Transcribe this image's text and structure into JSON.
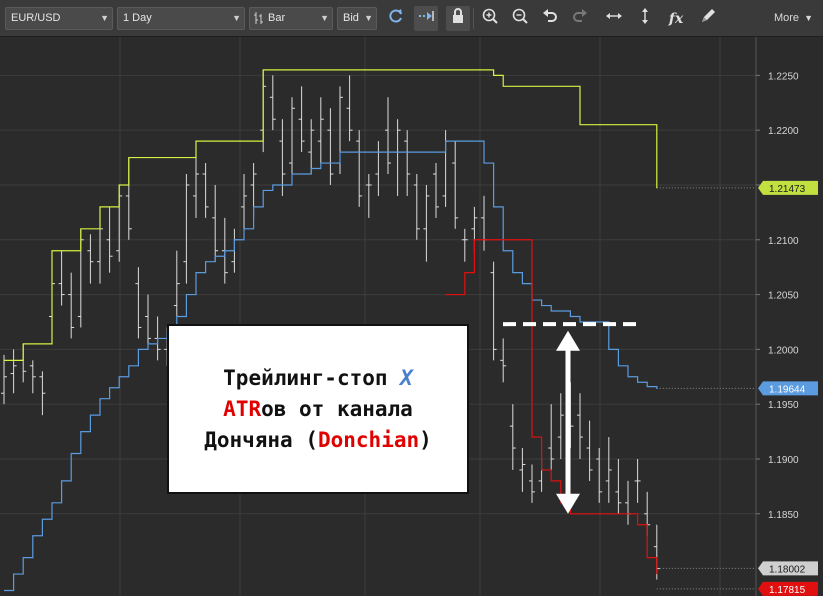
{
  "toolbar": {
    "symbol": "EUR/USD",
    "timeframe": "1 Day",
    "chart_type": "Bar",
    "price_type": "Bid",
    "more_label": "More",
    "icons": [
      "refresh-icon",
      "auto-scroll-icon",
      "lock-icon",
      "zoom-in-icon",
      "zoom-out-icon",
      "undo-icon",
      "redo-icon",
      "horizontal-fit-icon",
      "vertical-fit-icon",
      "indicators-fx-icon",
      "draw-pencil-icon"
    ]
  },
  "annotation": {
    "line1_a": "Трейлинг-стоп ",
    "line1_b": "X",
    "line2_a": "ATR",
    "line2_b": "ов от канала",
    "line3_a": "Дончяна (",
    "line3_b": "Donchian",
    "line3_c": ")",
    "colors": {
      "text": "#111111",
      "x": "#4a7fd0",
      "red": "#e00000"
    }
  },
  "chart_data": {
    "type": "bar",
    "price_axis": {
      "ylim": [
        1.1775,
        1.2285
      ],
      "ticks": [
        "1.2250",
        "1.2200",
        "1.2150",
        "1.2100",
        "1.2050",
        "1.2000",
        "1.1950",
        "1.1900",
        "1.1850"
      ]
    },
    "series": [
      {
        "name": "EUR/USD",
        "color": "#dcdcdc",
        "ohlc": [
          [
            1.196,
            1.1995,
            1.195,
            1.1975
          ],
          [
            1.1978,
            1.2,
            1.196,
            1.1985
          ],
          [
            1.199,
            1.2005,
            1.197,
            1.198
          ],
          [
            1.1985,
            1.199,
            1.196,
            1.1975
          ],
          [
            1.1975,
            1.198,
            1.194,
            1.196
          ],
          [
            1.203,
            1.208,
            1.202,
            1.206
          ],
          [
            1.206,
            1.209,
            1.204,
            1.205
          ],
          [
            1.205,
            1.207,
            1.201,
            1.202
          ],
          [
            1.203,
            1.211,
            1.202,
            1.21
          ],
          [
            1.209,
            1.2105,
            1.206,
            1.208
          ],
          [
            1.208,
            1.212,
            1.206,
            1.211
          ],
          [
            1.21,
            1.213,
            1.207,
            1.2085
          ],
          [
            1.209,
            1.215,
            1.208,
            1.214
          ],
          [
            1.214,
            1.2175,
            1.21,
            1.211
          ],
          [
            1.206,
            1.2075,
            1.201,
            1.202
          ],
          [
            1.203,
            1.205,
            1.2,
            1.201
          ],
          [
            1.201,
            1.203,
            1.199,
            1.2
          ],
          [
            1.2,
            1.202,
            1.1985,
            1.1995
          ],
          [
            1.204,
            1.209,
            1.203,
            1.206
          ],
          [
            1.208,
            1.216,
            1.206,
            1.215
          ],
          [
            1.214,
            1.219,
            1.212,
            1.216
          ],
          [
            1.216,
            1.217,
            1.212,
            1.213
          ],
          [
            1.212,
            1.215,
            1.208,
            1.209
          ],
          [
            1.209,
            1.212,
            1.206,
            1.207
          ],
          [
            1.208,
            1.211,
            1.207,
            1.21
          ],
          [
            1.213,
            1.216,
            1.211,
            1.214
          ],
          [
            1.215,
            1.217,
            1.212,
            1.216
          ],
          [
            1.22,
            1.2255,
            1.218,
            1.224
          ],
          [
            1.223,
            1.225,
            1.22,
            1.221
          ],
          [
            1.219,
            1.221,
            1.214,
            1.216
          ],
          [
            1.217,
            1.223,
            1.215,
            1.222
          ],
          [
            1.221,
            1.224,
            1.218,
            1.219
          ],
          [
            1.218,
            1.221,
            1.216,
            1.22
          ],
          [
            1.219,
            1.223,
            1.217,
            1.221
          ],
          [
            1.22,
            1.222,
            1.215,
            1.216
          ],
          [
            1.217,
            1.224,
            1.216,
            1.223
          ],
          [
            1.222,
            1.225,
            1.219,
            1.22
          ],
          [
            1.219,
            1.22,
            1.213,
            1.214
          ],
          [
            1.215,
            1.216,
            1.212,
            1.215
          ],
          [
            1.216,
            1.219,
            1.214,
            1.218
          ],
          [
            1.22,
            1.223,
            1.216,
            1.217
          ],
          [
            1.218,
            1.221,
            1.214,
            1.22
          ],
          [
            1.219,
            1.22,
            1.214,
            1.216
          ],
          [
            1.215,
            1.216,
            1.21,
            1.211
          ],
          [
            1.211,
            1.215,
            1.208,
            1.214
          ],
          [
            1.216,
            1.217,
            1.212,
            1.213
          ],
          [
            1.214,
            1.22,
            1.213,
            1.219
          ],
          [
            1.217,
            1.219,
            1.211,
            1.212
          ],
          [
            1.21,
            1.211,
            1.208,
            1.21
          ],
          [
            1.211,
            1.213,
            1.209,
            1.212
          ],
          [
            1.212,
            1.214,
            1.209,
            1.21
          ],
          [
            1.207,
            1.208,
            1.199,
            1.2
          ],
          [
            1.199,
            1.201,
            1.197,
            1.1985
          ],
          [
            1.193,
            1.195,
            1.189,
            1.191
          ],
          [
            1.189,
            1.191,
            1.187,
            1.1895
          ],
          [
            1.188,
            1.1895,
            1.186,
            1.187
          ],
          [
            1.188,
            1.19,
            1.187,
            1.189
          ],
          [
            1.191,
            1.195,
            1.189,
            1.19
          ],
          [
            1.192,
            1.196,
            1.19,
            1.194
          ],
          [
            1.194,
            1.197,
            1.191,
            1.193
          ],
          [
            1.194,
            1.196,
            1.19,
            1.192
          ],
          [
            1.191,
            1.1935,
            1.188,
            1.189
          ],
          [
            1.19,
            1.191,
            1.186,
            1.187
          ],
          [
            1.188,
            1.192,
            1.186,
            1.189
          ],
          [
            1.187,
            1.19,
            1.185,
            1.186
          ],
          [
            1.186,
            1.188,
            1.184,
            1.185
          ],
          [
            1.188,
            1.19,
            1.186,
            1.188
          ],
          [
            1.185,
            1.187,
            1.183,
            1.184
          ],
          [
            1.182,
            1.184,
            1.179,
            1.18
          ]
        ]
      },
      {
        "name": "Donchian upper",
        "color": "#d8f040",
        "values": [
          1.199,
          1.199,
          1.2005,
          1.2005,
          1.2005,
          1.209,
          1.209,
          1.209,
          1.211,
          1.211,
          1.213,
          1.213,
          1.215,
          1.2175,
          1.2175,
          1.2175,
          1.2175,
          1.2175,
          1.2175,
          1.2175,
          1.219,
          1.219,
          1.219,
          1.219,
          1.219,
          1.219,
          1.219,
          1.2255,
          1.2255,
          1.2255,
          1.2255,
          1.2255,
          1.2255,
          1.2255,
          1.2255,
          1.2255,
          1.2255,
          1.2255,
          1.2255,
          1.2255,
          1.2255,
          1.2255,
          1.2255,
          1.2255,
          1.2255,
          1.2255,
          1.2255,
          1.2255,
          1.2255,
          1.2255,
          1.2255,
          1.225,
          1.224,
          1.224,
          1.224,
          1.224,
          1.224,
          1.224,
          1.224,
          1.224,
          1.2205,
          1.2205,
          1.2205,
          1.2205,
          1.2205,
          1.2205,
          1.2205,
          1.2205,
          1.2147
        ]
      },
      {
        "name": "Trailing stop long",
        "color": "#5b9be0",
        "values": [
          1.178,
          1.1795,
          1.181,
          1.183,
          1.1845,
          1.186,
          1.188,
          1.1905,
          1.1925,
          1.194,
          1.1955,
          1.1965,
          1.1975,
          1.1985,
          1.2,
          1.2005,
          1.201,
          1.2015,
          1.203,
          1.205,
          1.207,
          1.208,
          1.2085,
          1.209,
          1.21,
          1.211,
          1.213,
          1.2145,
          1.215,
          1.215,
          1.216,
          1.216,
          1.2165,
          1.217,
          1.217,
          1.218,
          1.218,
          1.218,
          1.218,
          1.218,
          1.218,
          1.218,
          1.218,
          1.218,
          1.218,
          1.218,
          1.219,
          1.219,
          1.219,
          1.219,
          1.217,
          1.213,
          1.209,
          1.207,
          1.206,
          1.2045,
          1.204,
          1.2035,
          1.2035,
          1.203,
          1.2025,
          1.2025,
          1.2025,
          1.2,
          1.1985,
          1.1975,
          1.197,
          1.1966,
          1.1964
        ]
      },
      {
        "name": "Trailing stop short",
        "color": "#e01010",
        "values": [
          null,
          null,
          null,
          null,
          null,
          null,
          null,
          null,
          null,
          null,
          null,
          null,
          null,
          null,
          null,
          null,
          null,
          null,
          null,
          null,
          null,
          null,
          null,
          null,
          null,
          null,
          null,
          null,
          null,
          null,
          null,
          null,
          null,
          null,
          null,
          null,
          null,
          null,
          null,
          null,
          null,
          null,
          null,
          null,
          null,
          null,
          1.205,
          1.205,
          1.207,
          1.21,
          1.21,
          1.21,
          1.21,
          1.21,
          1.21,
          1.192,
          1.189,
          1.188,
          1.186,
          1.185,
          1.185,
          1.185,
          1.185,
          1.185,
          1.185,
          1.185,
          1.184,
          1.181,
          1.1795
        ]
      }
    ],
    "markers": {
      "support_level": 1.2023,
      "arrow_from": 1.2017,
      "arrow_to": 1.185
    },
    "price_tags": [
      {
        "label": "1.21473",
        "bg": "#c2e040",
        "fg": "#1a1a1a"
      },
      {
        "label": "1.19644",
        "bg": "#5b9be0",
        "fg": "#ffffff"
      },
      {
        "label": "1.18002",
        "bg": "#cfcfcf",
        "fg": "#1a1a1a"
      },
      {
        "label": "1.17815",
        "bg": "#e01010",
        "fg": "#ffffff"
      }
    ],
    "grid": true
  }
}
